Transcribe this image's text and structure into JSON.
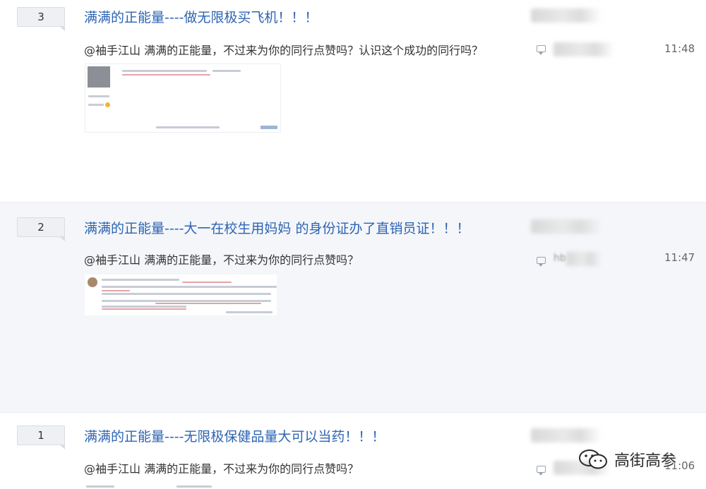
{
  "posts": [
    {
      "reply_count": "3",
      "title": "满满的正能量----做无限极买飞机！！！",
      "abstract": "@袖手江山 满满的正能量，不过来为你的同行点赞吗？认识这个成功的同行吗？",
      "time": "11:48",
      "last_replier": ""
    },
    {
      "reply_count": "2",
      "title": "满满的正能量----大一在校生用妈妈 的身份证办了直销员证！！！",
      "abstract": "@袖手江山 满满的正能量，不过来为你的同行点赞吗？",
      "time": "11:47",
      "last_replier": "hb"
    },
    {
      "reply_count": "1",
      "title": "满满的正能量----无限极保健品量大可以当药！！！",
      "abstract": "@袖手江山 满满的正能量，不过来为你的同行点赞吗？",
      "time": "11:06",
      "last_replier": ""
    }
  ],
  "watermark": {
    "text": "高街高参",
    "icon": "wechat-icon"
  },
  "colors": {
    "title_link": "#2d64b3",
    "row_alt_bg": "#f4f6f9",
    "text": "#333333",
    "meta": "#666666"
  }
}
